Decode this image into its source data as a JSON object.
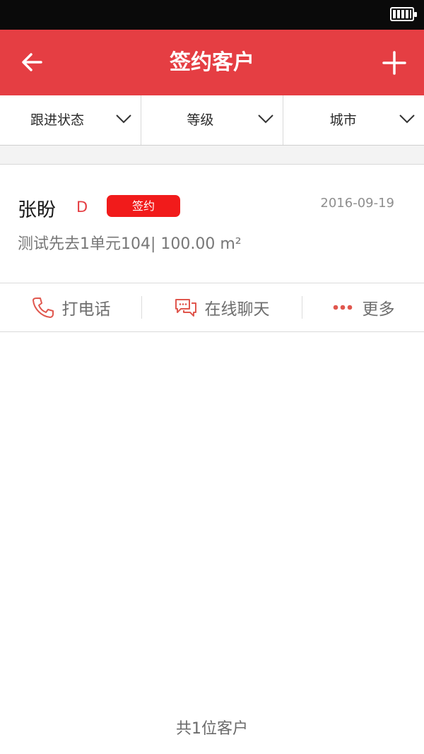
{
  "header": {
    "title": "签约客户"
  },
  "filters": [
    {
      "label": "跟进状态"
    },
    {
      "label": "等级"
    },
    {
      "label": "城市"
    }
  ],
  "customer": {
    "name": "张盼",
    "grade": "D",
    "status_badge": "签约",
    "date": "2016-09-19",
    "description": "测试先去1单元104| 100.00 m²"
  },
  "actions": [
    {
      "label": "打电话",
      "icon": "phone-icon"
    },
    {
      "label": "在线聊天",
      "icon": "chat-icon"
    },
    {
      "label": "更多",
      "icon": "more-dots-icon"
    }
  ],
  "footer": {
    "summary": "共1位客户"
  },
  "colors": {
    "accent": "#e53e43",
    "badge": "#f11b1b",
    "icon": "#e0574e"
  }
}
